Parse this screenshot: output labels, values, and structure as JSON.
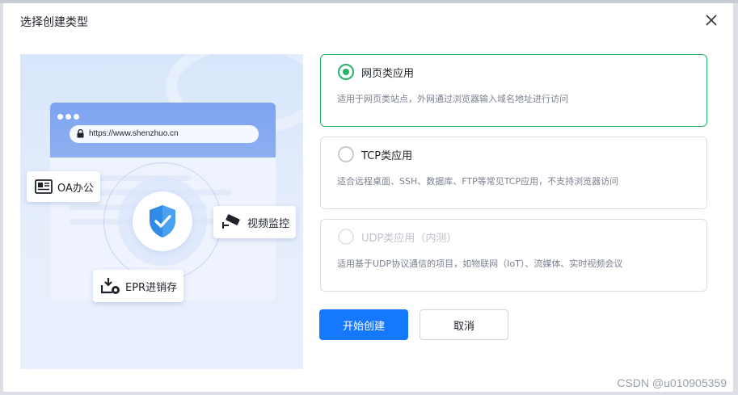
{
  "dialog": {
    "title": "选择创建类型"
  },
  "illustration": {
    "url": "https://www.shenzhuo.cn",
    "tags": {
      "oa": "OA办公",
      "video": "视频监控",
      "epr": "EPR进销存"
    }
  },
  "options": [
    {
      "title": "网页类应用",
      "description": "适用于网页类站点，外网通过浏览器输入域名地址进行访问",
      "state": "selected"
    },
    {
      "title": "TCP类应用",
      "description": "适合远程桌面、SSH、数据库、FTP等常见TCP应用，不支持浏览器访问",
      "state": "unselected"
    },
    {
      "title": "UDP类应用（内测）",
      "description": "适用基于UDP协议通信的项目，如物联网（IoT）、流媒体、实时视频会议",
      "state": "disabled"
    }
  ],
  "actions": {
    "create_label": "开始创建",
    "cancel_label": "取消"
  },
  "watermark": "CSDN @u010905359",
  "colors": {
    "primary": "#1677ff",
    "selected": "#25b36a"
  }
}
